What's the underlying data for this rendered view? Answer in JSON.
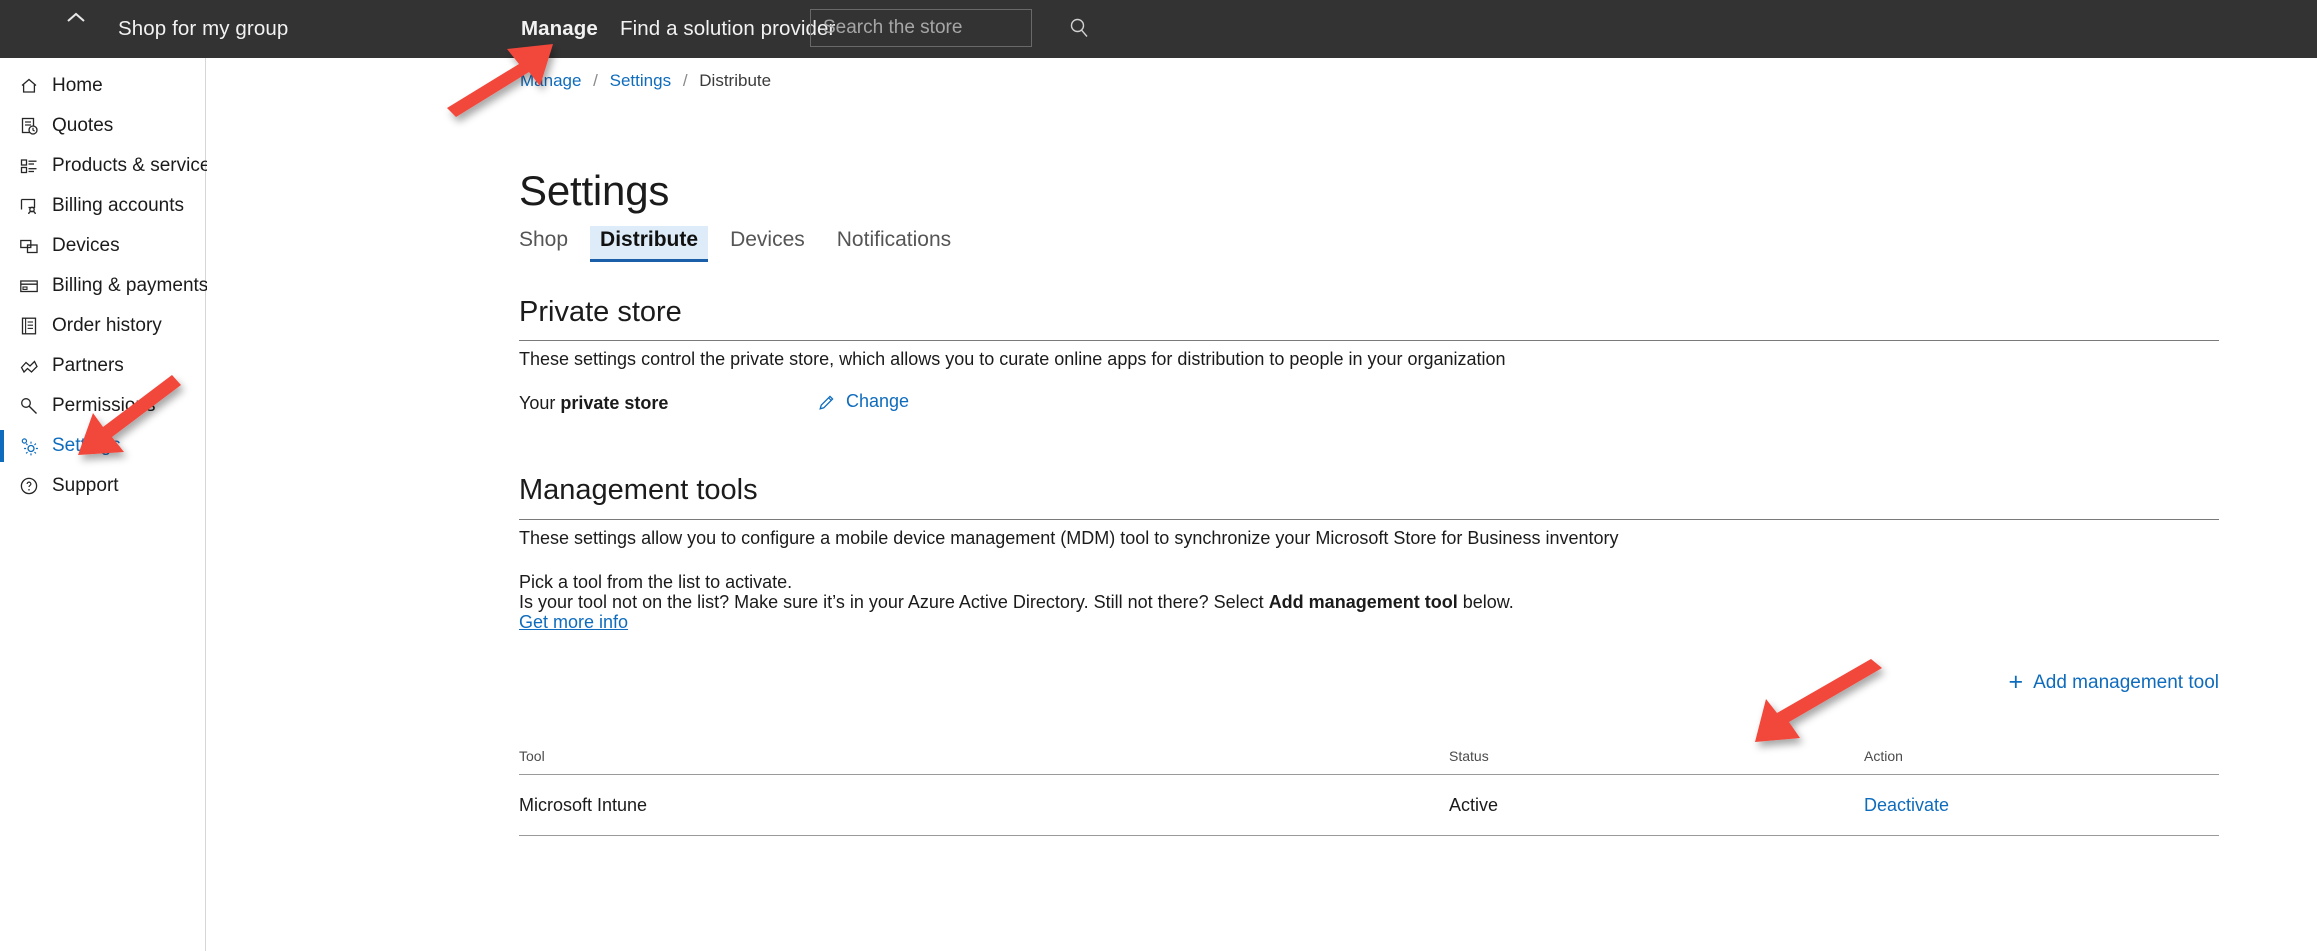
{
  "topbar": {
    "collapse_icon": "chevron-up-icon",
    "shop_for_group": "Shop for my group",
    "manage": "Manage",
    "find_solution_provider": "Find a solution provider",
    "search_placeholder": "Search the store",
    "search_value": "",
    "search_icon": "search-icon",
    "background": "#333333"
  },
  "sidebar": {
    "items": [
      {
        "label": "Home",
        "icon": "home-icon",
        "active": false
      },
      {
        "label": "Quotes",
        "icon": "quotes-icon",
        "active": false
      },
      {
        "label": "Products & services",
        "icon": "products-icon",
        "active": false
      },
      {
        "label": "Billing accounts",
        "icon": "billing-accounts-icon",
        "active": false
      },
      {
        "label": "Devices",
        "icon": "devices-icon",
        "active": false
      },
      {
        "label": "Billing & payments",
        "icon": "credit-card-icon",
        "active": false
      },
      {
        "label": "Order history",
        "icon": "order-history-icon",
        "active": false
      },
      {
        "label": "Partners",
        "icon": "partners-icon",
        "active": false
      },
      {
        "label": "Permissions",
        "icon": "key-icon",
        "active": false
      },
      {
        "label": "Settings",
        "icon": "gear-icon",
        "active": true
      },
      {
        "label": "Support",
        "icon": "question-circle-icon",
        "active": false
      }
    ],
    "active_color": "#0f6cbd"
  },
  "breadcrumb": {
    "manage": "Manage",
    "settings": "Settings",
    "current": "Distribute",
    "separator": "/"
  },
  "page": {
    "title": "Settings"
  },
  "tabs": [
    {
      "label": "Shop",
      "selected": false
    },
    {
      "label": "Distribute",
      "selected": true
    },
    {
      "label": "Devices",
      "selected": false
    },
    {
      "label": "Notifications",
      "selected": false
    }
  ],
  "private_store": {
    "heading": "Private store",
    "description": "These settings control the private store, which allows you to curate online apps for distribution to people in your organization",
    "row_label_prefix": "Your ",
    "row_label_bold": "private store",
    "change_link": "Change",
    "change_icon": "pencil-icon"
  },
  "management_tools": {
    "heading": "Management tools",
    "description": "These settings allow you to configure a mobile device management (MDM) tool to synchronize your Microsoft Store for Business inventory",
    "pick_tool_line": "Pick a tool from the list to activate.",
    "not_on_list_prefix": "Is your tool not on the list? Make sure it’s in your Azure Active Directory. Still not there? Select ",
    "not_on_list_bold": "Add management tool",
    "not_on_list_suffix": " below.",
    "get_more_info": "Get more info",
    "add_tool_button": "Add management tool",
    "add_tool_icon": "plus-icon",
    "table": {
      "columns": [
        "Tool",
        "Status",
        "Action"
      ],
      "rows": [
        {
          "tool": "Microsoft Intune",
          "status": "Active",
          "action": "Deactivate"
        }
      ]
    }
  },
  "annotations": {
    "arrow_color": "#f2463a",
    "arrows": [
      {
        "name": "arrow-to-manage-nav",
        "points_to": "Manage"
      },
      {
        "name": "arrow-to-settings-nav",
        "points_to": "Settings"
      },
      {
        "name": "arrow-to-deactivate",
        "points_to": "Deactivate"
      }
    ]
  }
}
